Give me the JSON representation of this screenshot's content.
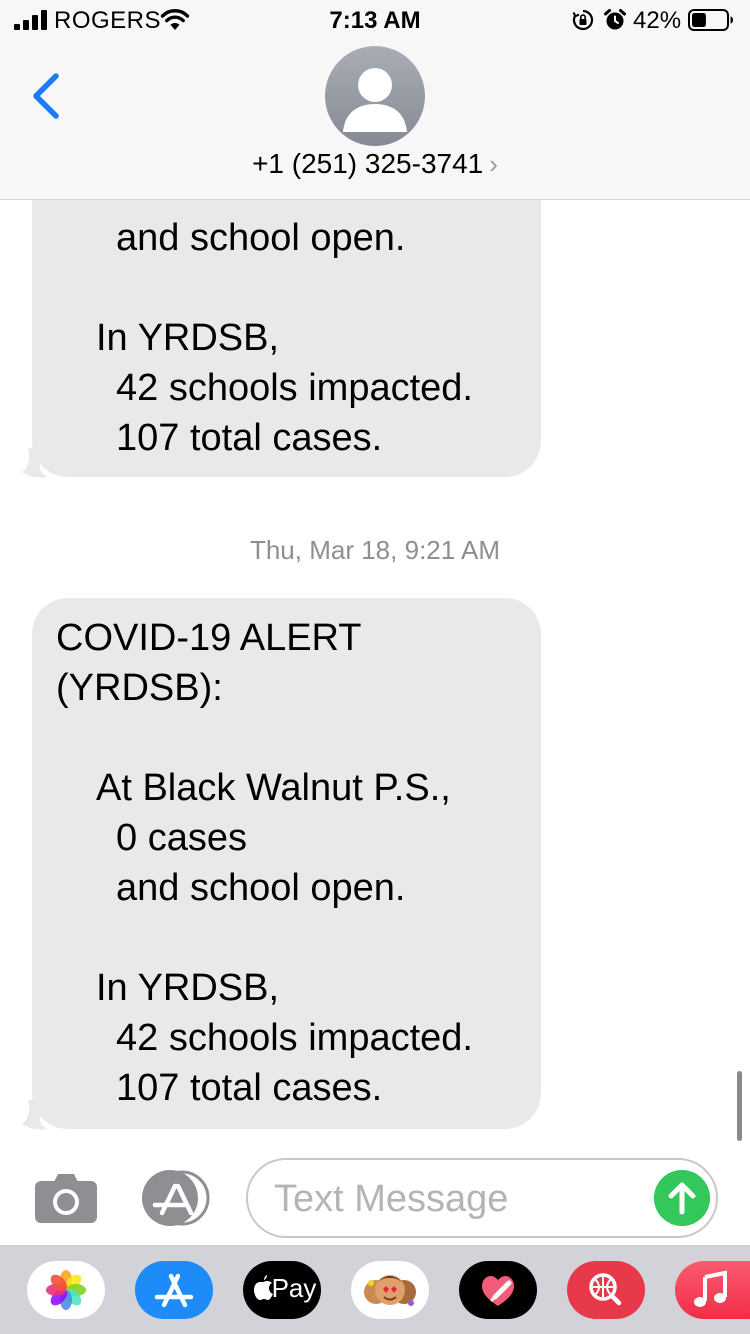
{
  "status_bar": {
    "carrier": "ROGERS",
    "time": "7:13 AM",
    "battery_percent": "42%",
    "battery_level": 0.42
  },
  "header": {
    "contact_phone": "+1 (251) 325-3741",
    "contact_chevron": "›"
  },
  "messages": [
    {
      "sender": "incoming",
      "lines": [
        "and school open.",
        "In YRDSB,",
        "42 schools impacted.",
        "107 total cases."
      ]
    },
    {
      "sender": "incoming",
      "timestamp_day": "Thu, Mar 18,",
      "timestamp_time": "9:21 AM",
      "lines": [
        "COVID-19 ALERT",
        "(YRDSB):",
        "At Black Walnut P.S.,",
        "0 cases",
        "and school open.",
        "In YRDSB,",
        "42 schools impacted.",
        "107 total cases."
      ]
    }
  ],
  "input_bar": {
    "placeholder": "Text Message"
  },
  "app_drawer": {
    "applepay_label": "Pay",
    "apps": [
      "photos-icon",
      "app-store-icon",
      "apple-pay-icon",
      "memoji-icon",
      "digital-touch-icon",
      "web-search-icon",
      "music-icon"
    ]
  },
  "colors": {
    "accent_blue": "#1a7cf5",
    "bubble_gray": "#e9e9eb",
    "send_green": "#34c759",
    "header_bg": "#f7f7f7"
  }
}
